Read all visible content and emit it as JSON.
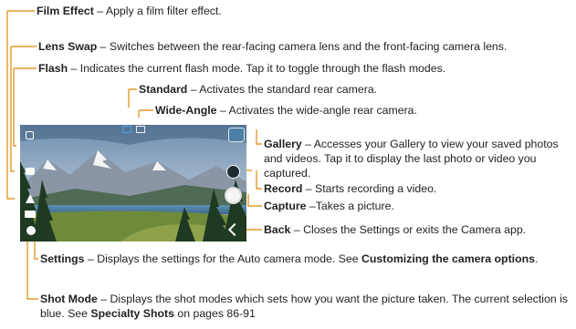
{
  "annotations": {
    "film_effect": {
      "name": "Film Effect",
      "desc": " – Apply a film filter effect."
    },
    "lens_swap": {
      "name": "Lens Swap",
      "desc": " – Switches between the rear-facing camera lens and the front-facing camera lens."
    },
    "flash": {
      "name": "Flash",
      "desc": " – Indicates the current flash mode. Tap it to toggle through the flash modes."
    },
    "standard": {
      "name": "Standard",
      "desc": " – Activates the standard rear camera."
    },
    "wide_angle": {
      "name": "Wide-Angle",
      "desc": " – Activates the wide-angle rear camera."
    },
    "gallery": {
      "name": "Gallery",
      "desc": " – Accesses your Gallery to view your saved photos and videos. Tap it to display the last photo or video you captured."
    },
    "record": {
      "name": "Record",
      "desc": " – Starts recording a video."
    },
    "capture": {
      "name": "Capture",
      "desc": " –Takes a picture."
    },
    "back": {
      "name": "Back",
      "desc": " – Closes the Settings or exits the Camera app."
    },
    "settings": {
      "name": "Settings",
      "desc": " – Displays the settings for the Auto camera mode. See ",
      "link": "Customizing the camera options",
      "tail": "."
    },
    "shot_mode": {
      "name": "Shot Mode",
      "desc": " – Displays the shot modes which sets how you want the picture taken. The current selection is blue. See ",
      "link": "Specialty Shots",
      "tail": " on pages 86-91"
    }
  },
  "colors": {
    "leader_line": "#e39a2a",
    "selection_blue": "#4aa3df"
  },
  "icons": [
    "settings-icon",
    "shot-mode-icon",
    "flash-icon",
    "lens-swap-icon",
    "film-effect-icon",
    "standard-lens-icon",
    "wide-angle-lens-icon",
    "gallery-thumbnail",
    "record-icon",
    "capture-icon",
    "back-icon"
  ]
}
